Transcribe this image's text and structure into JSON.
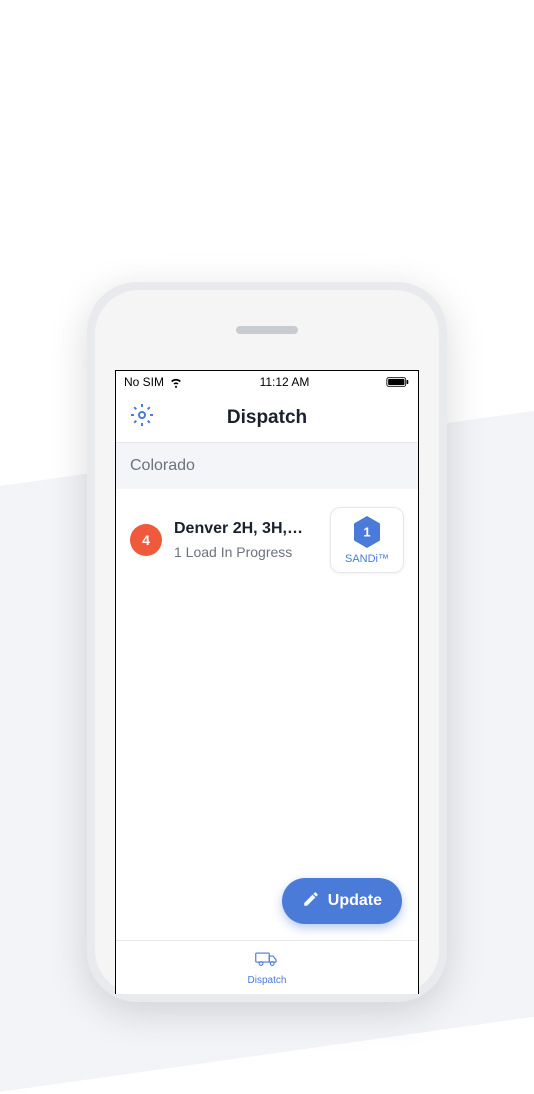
{
  "status_bar": {
    "carrier": "No SIM",
    "time": "11:12 AM"
  },
  "nav": {
    "title": "Dispatch"
  },
  "section": {
    "header": "Colorado"
  },
  "item": {
    "badge_count": "4",
    "title": "Denver 2H, 3H,…",
    "subtitle": "1 Load In Progress",
    "sandi_count": "1",
    "sandi_label": "SANDi™"
  },
  "actions": {
    "update_label": "Update"
  },
  "tabs": {
    "dispatch_label": "Dispatch"
  },
  "colors": {
    "accent": "#4a7bd8",
    "badge": "#f05a3c"
  }
}
